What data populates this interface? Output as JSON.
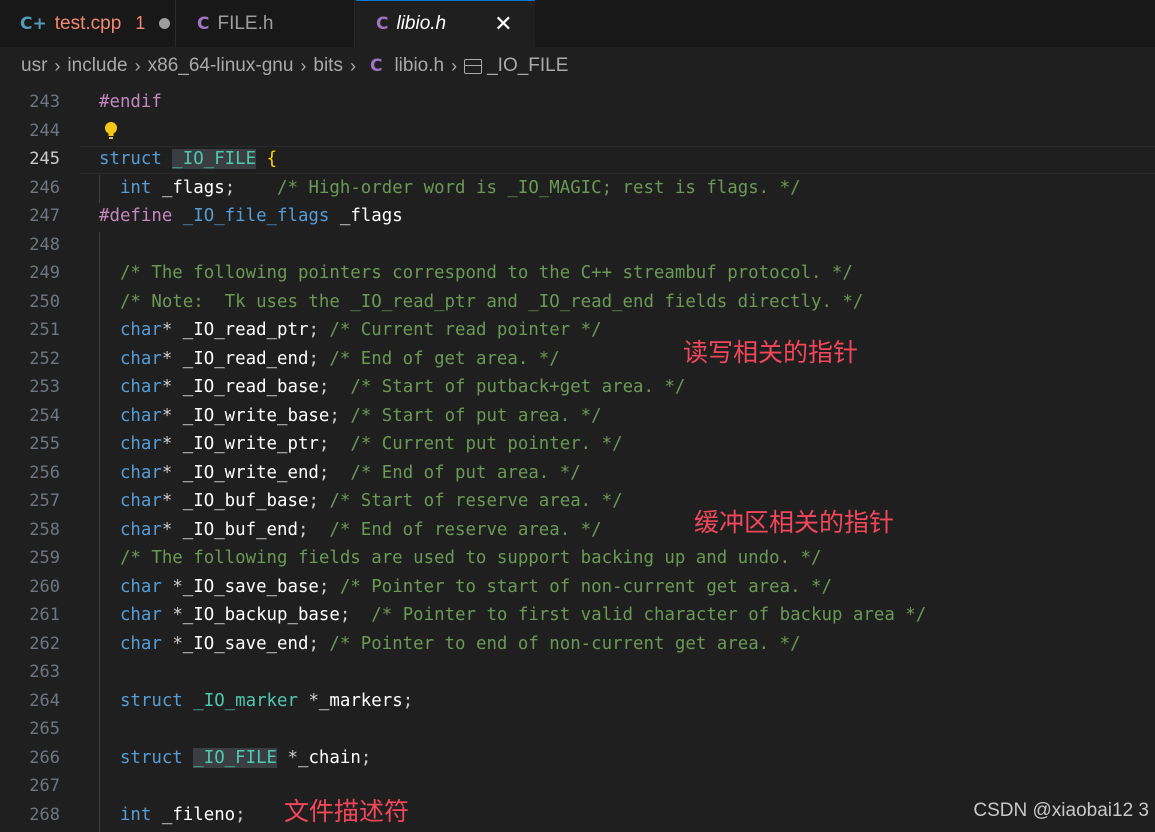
{
  "tabs": [
    {
      "icon": "C+",
      "name": "test.cpp",
      "badge": "1"
    },
    {
      "icon": "C",
      "name": "FILE.h"
    },
    {
      "icon": "C",
      "name": "libio.h",
      "close": "✕"
    }
  ],
  "breadcrumb": {
    "parts": [
      "usr",
      "include",
      "x86_64-linux-gnu",
      "bits"
    ],
    "file_icon": "C",
    "file": "libio.h",
    "symbol": "_IO_FILE"
  },
  "editor": {
    "active_line": "245",
    "line_numbers": [
      "243",
      "244",
      "245",
      "246",
      "247",
      "248",
      "249",
      "250",
      "251",
      "252",
      "253",
      "254",
      "255",
      "256",
      "257",
      "258",
      "259",
      "260",
      "261",
      "262",
      "263",
      "264",
      "265",
      "266",
      "267",
      "268"
    ],
    "lines": [
      {
        "t": [
          [
            "pp",
            "#endif"
          ]
        ]
      },
      {
        "t": []
      },
      {
        "t": [
          [
            "kw",
            "struct"
          ],
          [
            "pu",
            " "
          ],
          [
            "ty hl",
            "_IO_FILE"
          ],
          [
            "pu",
            " "
          ],
          [
            "br",
            "{"
          ]
        ]
      },
      {
        "t": [
          [
            "pu",
            "  "
          ],
          [
            "kw",
            "int"
          ],
          [
            "pu",
            " "
          ],
          [
            "id",
            "_flags"
          ],
          [
            "pu",
            ";    "
          ],
          [
            "cm",
            "/* High-order word is _IO_MAGIC; rest is flags. */"
          ]
        ]
      },
      {
        "t": [
          [
            "pp",
            "#define"
          ],
          [
            "pu",
            " "
          ],
          [
            "kw",
            "_IO_file_flags"
          ],
          [
            "pu",
            " "
          ],
          [
            "id",
            "_flags"
          ]
        ]
      },
      {
        "t": []
      },
      {
        "t": [
          [
            "pu",
            "  "
          ],
          [
            "cm",
            "/* The following pointers correspond to the C++ streambuf protocol. */"
          ]
        ]
      },
      {
        "t": [
          [
            "pu",
            "  "
          ],
          [
            "cm",
            "/* Note:  Tk uses the _IO_read_ptr and _IO_read_end fields directly. */"
          ]
        ]
      },
      {
        "t": [
          [
            "pu",
            "  "
          ],
          [
            "kw",
            "char"
          ],
          [
            "pu",
            "* "
          ],
          [
            "id",
            "_IO_read_ptr"
          ],
          [
            "pu",
            "; "
          ],
          [
            "cm",
            "/* Current read pointer */"
          ]
        ]
      },
      {
        "t": [
          [
            "pu",
            "  "
          ],
          [
            "kw",
            "char"
          ],
          [
            "pu",
            "* "
          ],
          [
            "id",
            "_IO_read_end"
          ],
          [
            "pu",
            "; "
          ],
          [
            "cm",
            "/* End of get area. */"
          ]
        ]
      },
      {
        "t": [
          [
            "pu",
            "  "
          ],
          [
            "kw",
            "char"
          ],
          [
            "pu",
            "* "
          ],
          [
            "id",
            "_IO_read_base"
          ],
          [
            "pu",
            ";  "
          ],
          [
            "cm",
            "/* Start of putback+get area. */"
          ]
        ]
      },
      {
        "t": [
          [
            "pu",
            "  "
          ],
          [
            "kw",
            "char"
          ],
          [
            "pu",
            "* "
          ],
          [
            "id",
            "_IO_write_base"
          ],
          [
            "pu",
            "; "
          ],
          [
            "cm",
            "/* Start of put area. */"
          ]
        ]
      },
      {
        "t": [
          [
            "pu",
            "  "
          ],
          [
            "kw",
            "char"
          ],
          [
            "pu",
            "* "
          ],
          [
            "id",
            "_IO_write_ptr"
          ],
          [
            "pu",
            ";  "
          ],
          [
            "cm",
            "/* Current put pointer. */"
          ]
        ]
      },
      {
        "t": [
          [
            "pu",
            "  "
          ],
          [
            "kw",
            "char"
          ],
          [
            "pu",
            "* "
          ],
          [
            "id",
            "_IO_write_end"
          ],
          [
            "pu",
            ";  "
          ],
          [
            "cm",
            "/* End of put area. */"
          ]
        ]
      },
      {
        "t": [
          [
            "pu",
            "  "
          ],
          [
            "kw",
            "char"
          ],
          [
            "pu",
            "* "
          ],
          [
            "id",
            "_IO_buf_base"
          ],
          [
            "pu",
            "; "
          ],
          [
            "cm",
            "/* Start of reserve area. */"
          ]
        ]
      },
      {
        "t": [
          [
            "pu",
            "  "
          ],
          [
            "kw",
            "char"
          ],
          [
            "pu",
            "* "
          ],
          [
            "id",
            "_IO_buf_end"
          ],
          [
            "pu",
            ";  "
          ],
          [
            "cm",
            "/* End of reserve area. */"
          ]
        ]
      },
      {
        "t": [
          [
            "pu",
            "  "
          ],
          [
            "cm",
            "/* The following fields are used to support backing up and undo. */"
          ]
        ]
      },
      {
        "t": [
          [
            "pu",
            "  "
          ],
          [
            "kw",
            "char"
          ],
          [
            "pu",
            " *"
          ],
          [
            "id",
            "_IO_save_base"
          ],
          [
            "pu",
            "; "
          ],
          [
            "cm",
            "/* Pointer to start of non-current get area. */"
          ]
        ]
      },
      {
        "t": [
          [
            "pu",
            "  "
          ],
          [
            "kw",
            "char"
          ],
          [
            "pu",
            " *"
          ],
          [
            "id",
            "_IO_backup_base"
          ],
          [
            "pu",
            ";  "
          ],
          [
            "cm",
            "/* Pointer to first valid character of backup area */"
          ]
        ]
      },
      {
        "t": [
          [
            "pu",
            "  "
          ],
          [
            "kw",
            "char"
          ],
          [
            "pu",
            " *"
          ],
          [
            "id",
            "_IO_save_end"
          ],
          [
            "pu",
            "; "
          ],
          [
            "cm",
            "/* Pointer to end of non-current get area. */"
          ]
        ]
      },
      {
        "t": []
      },
      {
        "t": [
          [
            "pu",
            "  "
          ],
          [
            "kw",
            "struct"
          ],
          [
            "pu",
            " "
          ],
          [
            "ty",
            "_IO_marker"
          ],
          [
            "pu",
            " *"
          ],
          [
            "id",
            "_markers"
          ],
          [
            "pu",
            ";"
          ]
        ]
      },
      {
        "t": []
      },
      {
        "t": [
          [
            "pu",
            "  "
          ],
          [
            "kw",
            "struct"
          ],
          [
            "pu",
            " "
          ],
          [
            "ty hl",
            "_IO_FILE"
          ],
          [
            "pu",
            " *"
          ],
          [
            "id",
            "_chain"
          ],
          [
            "pu",
            ";"
          ]
        ]
      },
      {
        "t": []
      },
      {
        "t": [
          [
            "pu",
            "  "
          ],
          [
            "kw",
            "int"
          ],
          [
            "pu",
            " "
          ],
          [
            "id",
            "_fileno"
          ],
          [
            "pu",
            ";"
          ]
        ]
      }
    ]
  },
  "annotations": {
    "read_write": "读写相关的指针",
    "buffer": "缓冲区相关的指针",
    "fd": "文件描述符"
  },
  "watermark": "CSDN @xiaobai12 3",
  "colors": {
    "background": "#1f1f1f",
    "keyword": "#569cd6",
    "preprocessor": "#c586c0",
    "type": "#4ec9b0",
    "comment": "#6a9955",
    "annotation": "#f2475a",
    "active_tab_border": "#0078d4"
  }
}
